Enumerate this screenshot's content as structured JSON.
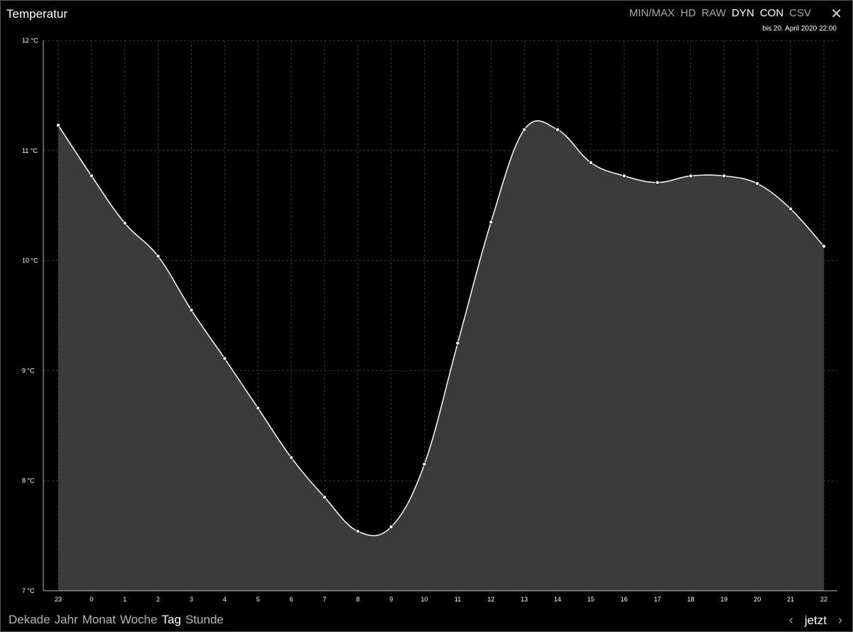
{
  "window": {
    "title": "Temperatur",
    "modes": [
      {
        "label": "MIN/MAX",
        "active": false
      },
      {
        "label": "HD",
        "active": false
      },
      {
        "label": "RAW",
        "active": false
      },
      {
        "label": "DYN",
        "active": true
      },
      {
        "label": "CON",
        "active": true
      },
      {
        "label": "CSV",
        "active": false
      }
    ],
    "close_icon": "close-icon",
    "range_label": "bis 20. April 2020 22:00"
  },
  "nav": {
    "periods": [
      {
        "label": "Dekade",
        "active": false
      },
      {
        "label": "Jahr",
        "active": false
      },
      {
        "label": "Monat",
        "active": false
      },
      {
        "label": "Woche",
        "active": false
      },
      {
        "label": "Tag",
        "active": true
      },
      {
        "label": "Stunde",
        "active": false
      }
    ],
    "prev_icon": "chevron-left-icon",
    "now_label": "jetzt",
    "next_icon": "chevron-right-icon"
  },
  "colors": {
    "background": "#000000",
    "area_fill": "#3b3b3b",
    "line": "#ffffff",
    "grid": "#3a3a3a"
  },
  "chart_data": {
    "type": "area",
    "x": [
      "23",
      "0",
      "1",
      "2",
      "3",
      "4",
      "5",
      "6",
      "7",
      "8",
      "9",
      "10",
      "11",
      "12",
      "13",
      "14",
      "15",
      "16",
      "17",
      "18",
      "19",
      "20",
      "21",
      "22"
    ],
    "values": [
      11.23,
      10.77,
      10.34,
      10.04,
      9.55,
      9.11,
      8.66,
      8.21,
      7.85,
      7.54,
      7.58,
      8.15,
      9.25,
      10.35,
      11.19,
      11.19,
      10.89,
      10.77,
      10.71,
      10.77,
      10.77,
      10.7,
      10.47,
      10.13
    ],
    "yticks": [
      7,
      8,
      9,
      10,
      11,
      12
    ],
    "ytick_labels": [
      "7 °C",
      "8 °C",
      "9 °C",
      "10 °C",
      "11 °C",
      "12 °C"
    ],
    "ylim": [
      7,
      12
    ],
    "grid": true,
    "title": "",
    "xlabel": "",
    "ylabel": ""
  }
}
